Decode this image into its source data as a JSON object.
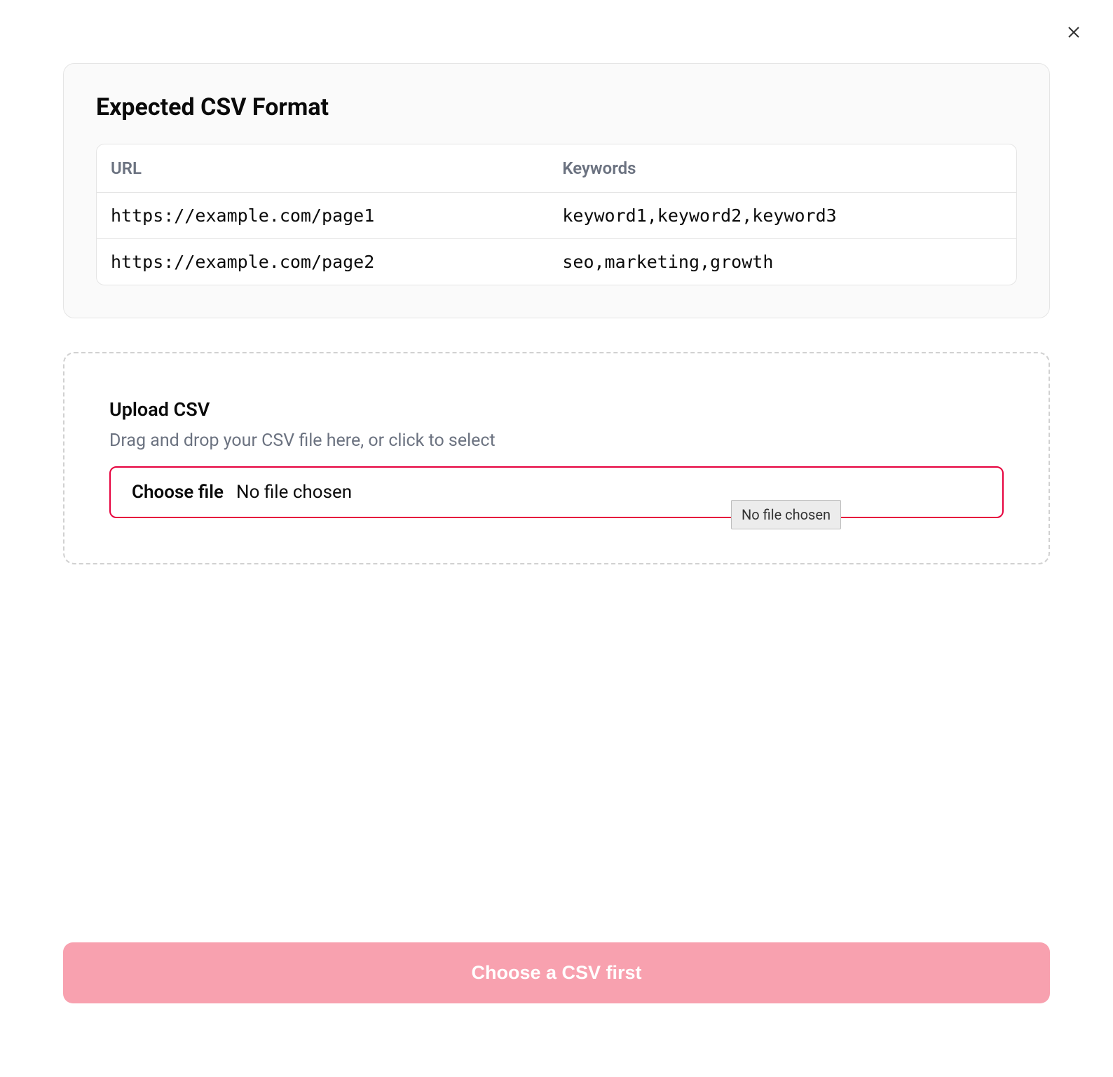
{
  "close_label": "Close",
  "format_section": {
    "title": "Expected CSV Format",
    "headers": [
      "URL",
      "Keywords"
    ],
    "rows": [
      {
        "url": "https://example.com/page1",
        "keywords": "keyword1,keyword2,keyword3"
      },
      {
        "url": "https://example.com/page2",
        "keywords": "seo,marketing,growth"
      }
    ]
  },
  "upload_section": {
    "title": "Upload CSV",
    "subtitle": "Drag and drop your CSV file here, or click to select",
    "choose_file_label": "Choose file",
    "no_file_text": "No file chosen",
    "tooltip_text": "No file chosen"
  },
  "submit_button": {
    "label": "Choose a CSV first"
  }
}
